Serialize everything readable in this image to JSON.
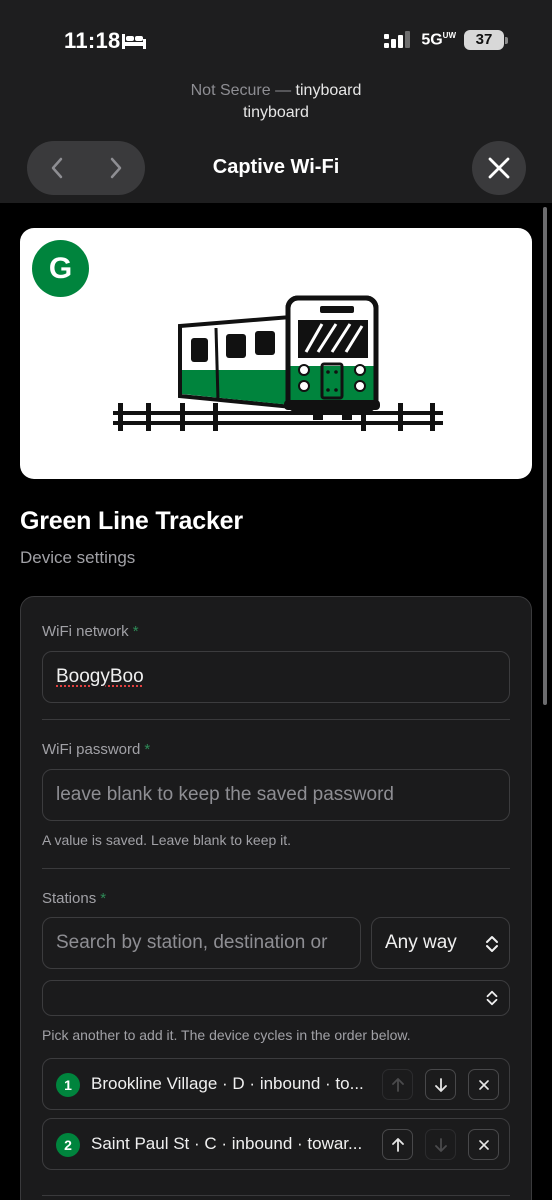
{
  "status_bar": {
    "time": "11:18",
    "network": "5G",
    "network_suffix": "UW",
    "battery": "37"
  },
  "browser": {
    "security": "Not Secure —",
    "host": "tinyboard",
    "site_name": "tinyboard",
    "title": "Captive Wi-Fi"
  },
  "hero": {
    "badge": "G",
    "accent": "#00843d"
  },
  "page": {
    "title": "Green Line Tracker",
    "subtitle": "Device settings"
  },
  "form": {
    "required_mark": "*",
    "wifi_network": {
      "label": "WiFi network",
      "value": "BoogyBoo"
    },
    "wifi_password": {
      "label": "WiFi password",
      "placeholder": "leave blank to keep the saved password",
      "hint": "A value is saved. Leave blank to keep it."
    },
    "stations": {
      "label": "Stations",
      "search_placeholder": "Search by station, destination or",
      "direction_value": "Any way",
      "hint": "Pick another to add it. The device cycles in the order below.",
      "items": [
        {
          "order": "1",
          "text": "Brookline Village · D · inbound · to...",
          "up_enabled": false,
          "down_enabled": true
        },
        {
          "order": "2",
          "text": "Saint Paul St · C · inbound · towar...",
          "up_enabled": true,
          "down_enabled": false
        }
      ]
    }
  },
  "colors": {
    "background": "#000000",
    "card": "#1b1b1c",
    "green_line": "#00843d"
  }
}
